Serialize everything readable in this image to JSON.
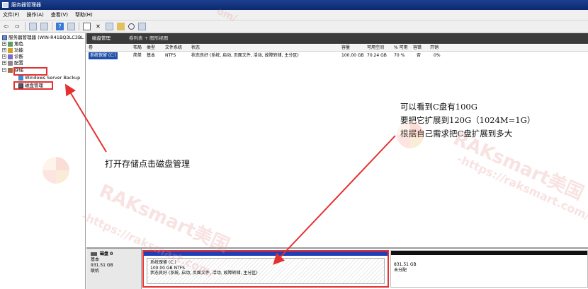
{
  "window": {
    "title": "服务器管理器"
  },
  "menu": [
    "文件(F)",
    "操作(A)",
    "查看(V)",
    "帮助(H)"
  ],
  "toolbar": {
    "icons": [
      "back-icon",
      "forward-icon",
      "up-icon",
      "show-tree-icon",
      "help-icon",
      "properties-icon",
      "delete-icon",
      "new-icon",
      "folder-icon",
      "search-icon",
      "view-icon"
    ],
    "delete_glyph": "✕"
  },
  "tree": {
    "root": "服务器管理器 (WIN-R41BQ3LC3BL",
    "roles": "角色",
    "features": "功能",
    "diagnostics": "诊断",
    "configuration": "配置",
    "storage": "存储",
    "windows_server_backup": "Windows Server Backup",
    "disk_management": "磁盘管理"
  },
  "content": {
    "header": "磁盘管理",
    "view_label": "卷列表 + 图形视图",
    "columns": [
      "卷",
      "布局",
      "类型",
      "文件系统",
      "状态",
      "容量",
      "可用空间",
      "% 可用",
      "容错",
      "开销"
    ],
    "rows": [
      {
        "volume": "系统保留 (C:)",
        "layout": "简单",
        "type": "基本",
        "fs": "NTFS",
        "status": "状态良好 (系统, 启动, 页面文件, 活动, 故障转储, 主分区)",
        "capacity": "100.00 GB",
        "free": "70.24 GB",
        "pct": "70 %",
        "ft": "否",
        "overhead": "0%"
      }
    ]
  },
  "annotations": {
    "left_note": "打开存储点击磁盘管理",
    "right_lines": [
      "可以看到C盘有100G",
      "要把它扩展到120G（1024M=1G）",
      "根据自己需求把C盘扩展到多大"
    ]
  },
  "disk": {
    "name": "磁盘 0",
    "type": "基本",
    "size": "931.51 GB",
    "status": "联机",
    "partition_c": {
      "name": "系统保留  (C:)",
      "size": "100.00 GB NTFS",
      "status": "状态良好 (系统, 启动, 页面文件, 活动, 故障转储, 主分区)"
    },
    "unallocated": {
      "size": "831.51 GB",
      "label": "未分配"
    }
  },
  "watermark": {
    "brand": "RAKsmart美国",
    "url": "-https://raksmart.com/",
    "url_short": "om/"
  },
  "colors": {
    "highlight": "#e53030",
    "partition_bar": "#1e3fb8",
    "header_bg": "#3a3a3a"
  }
}
